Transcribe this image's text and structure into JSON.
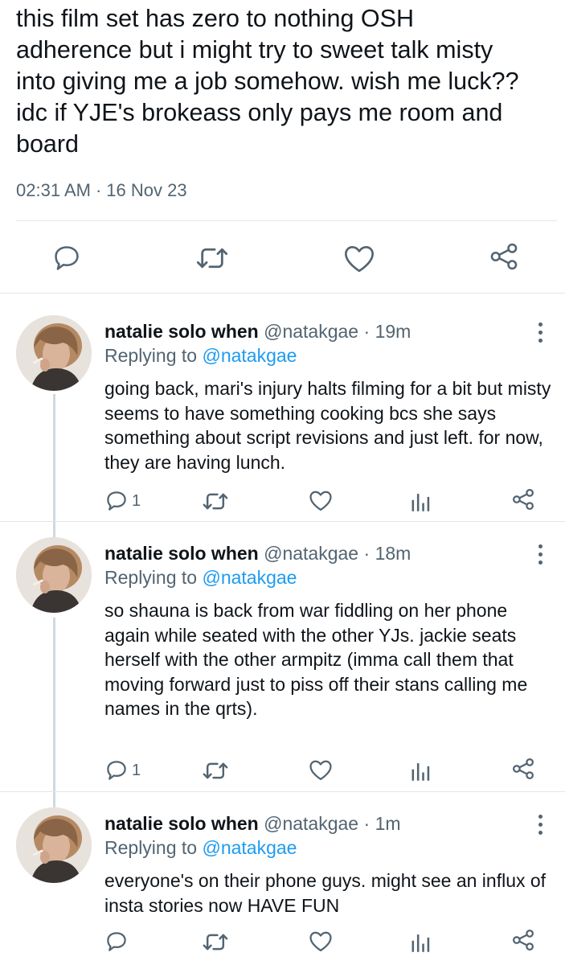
{
  "tweet": {
    "text": "this film set has zero to nothing OSH\nadherence but i might try to sweet talk misty\ninto giving me a job somehow. wish me luck??\nidc if YJE's brokeass only pays me room and\nboard",
    "time": "02:31 AM",
    "separator": "·",
    "date": "16 Nov 23"
  },
  "replies": [
    {
      "name": "natalie solo when",
      "handle": "@natakgae",
      "separator": "·",
      "time": "19m",
      "replying_prefix": "Replying to",
      "replying_handle": "@natakgae",
      "text": "going back, mari's injury halts filming for a bit but misty seems to have something cooking bcs she says something about script revisions and just left. for now, they are having lunch.",
      "reply_count": "1"
    },
    {
      "name": "natalie solo when",
      "handle": "@natakgae",
      "separator": "·",
      "time": "18m",
      "replying_prefix": "Replying to",
      "replying_handle": "@natakgae",
      "text": "so shauna is back from war fiddling on her phone again while seated with the other YJs. jackie seats herself with the other armpitz (imma call them that moving forward just to piss off their stans calling me names in the qrts).",
      "reply_count": "1"
    },
    {
      "name": "natalie solo when",
      "handle": "@natakgae",
      "separator": "·",
      "time": "1m",
      "replying_prefix": "Replying to",
      "replying_handle": "@natakgae",
      "text": "everyone's on their phone guys. might see an influx of insta stories now HAVE FUN",
      "reply_count": ""
    }
  ],
  "colors": {
    "text": "#0f1419",
    "secondary": "#536471",
    "link": "#1d9bf0",
    "divider": "#e1e6ea",
    "thread_line": "#cfd9de"
  },
  "icons": [
    "reply-icon",
    "retweet-icon",
    "like-icon",
    "share-icon",
    "analytics-icon",
    "more-icon"
  ]
}
